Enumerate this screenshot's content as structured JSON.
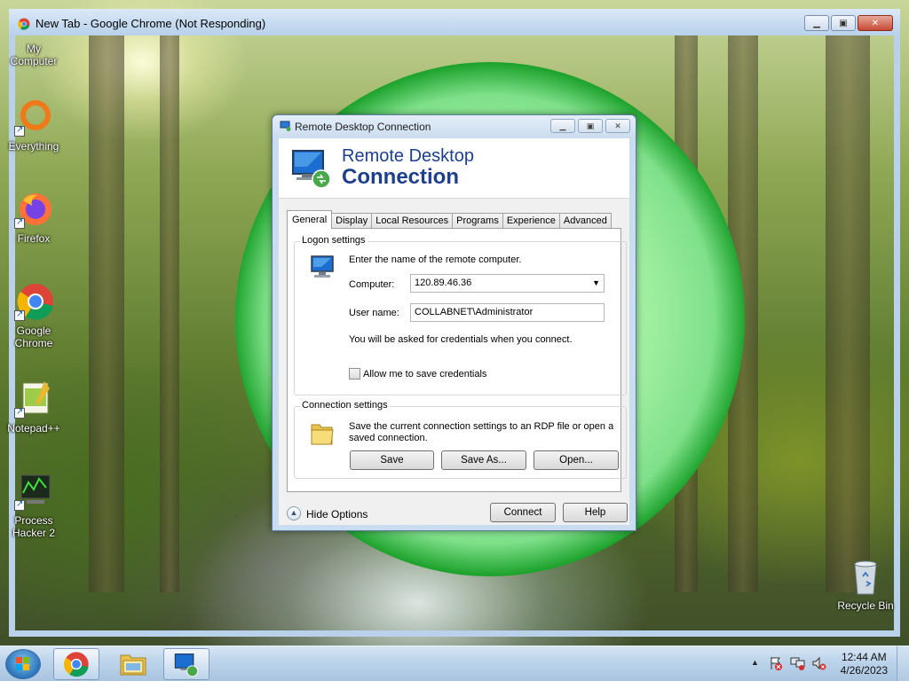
{
  "chrome_window": {
    "title": "New Tab - Google Chrome (Not Responding)"
  },
  "desktop_icons": [
    {
      "label": "My Computer"
    },
    {
      "label": "Everything"
    },
    {
      "label": "Firefox"
    },
    {
      "label": "Google Chrome"
    },
    {
      "label": "Notepad++"
    },
    {
      "label": "Process Hacker 2"
    },
    {
      "label": "Recycle Bin"
    }
  ],
  "rdp": {
    "window_title": "Remote Desktop Connection",
    "banner_line1": "Remote Desktop",
    "banner_line2": "Connection",
    "tabs": [
      "General",
      "Display",
      "Local Resources",
      "Programs",
      "Experience",
      "Advanced"
    ],
    "active_tab": "General",
    "logon": {
      "group_label": "Logon settings",
      "instruction": "Enter the name of the remote computer.",
      "computer_label": "Computer:",
      "computer_value": "120.89.46.36",
      "username_label": "User name:",
      "username_value": "COLLABNET\\Administrator",
      "credentials_note": "You will be asked for credentials when you connect.",
      "save_credentials_label": "Allow me to save credentials",
      "save_credentials_checked": false
    },
    "connection": {
      "group_label": "Connection settings",
      "description_line1": "Save the current connection settings to an RDP file or open a",
      "description_line2": "saved connection.",
      "save_label": "Save",
      "save_as_label": "Save As...",
      "open_label": "Open..."
    },
    "footer": {
      "hide_options_label": "Hide Options",
      "connect_label": "Connect",
      "help_label": "Help"
    }
  },
  "taskbar": {
    "clock_time": "12:44 AM",
    "clock_date": "4/26/2023",
    "items": [
      "start-orb",
      "chrome-icon",
      "explorer-icon",
      "remote-desktop-icon"
    ]
  }
}
